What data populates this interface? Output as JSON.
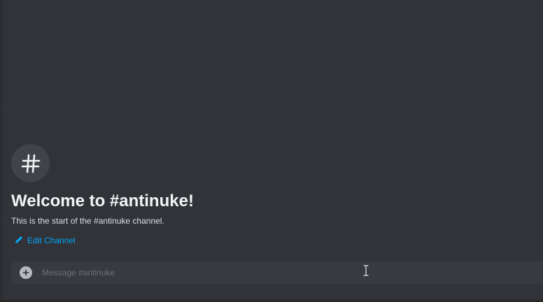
{
  "channel": {
    "name": "antinuke",
    "icon": "hashtag-icon"
  },
  "welcome": {
    "title": "Welcome to #antinuke!",
    "subtitle": "This is the start of the #antinuke channel.",
    "edit_label": "Edit Channel",
    "edit_icon": "pencil-icon"
  },
  "composer": {
    "placeholder": "Message #antinuke",
    "value": "",
    "add_icon": "plus-circle-icon"
  },
  "colors": {
    "background": "#313338",
    "link": "#00a8fc",
    "title": "#f2f3f5",
    "composer_bg": "#383a40"
  }
}
